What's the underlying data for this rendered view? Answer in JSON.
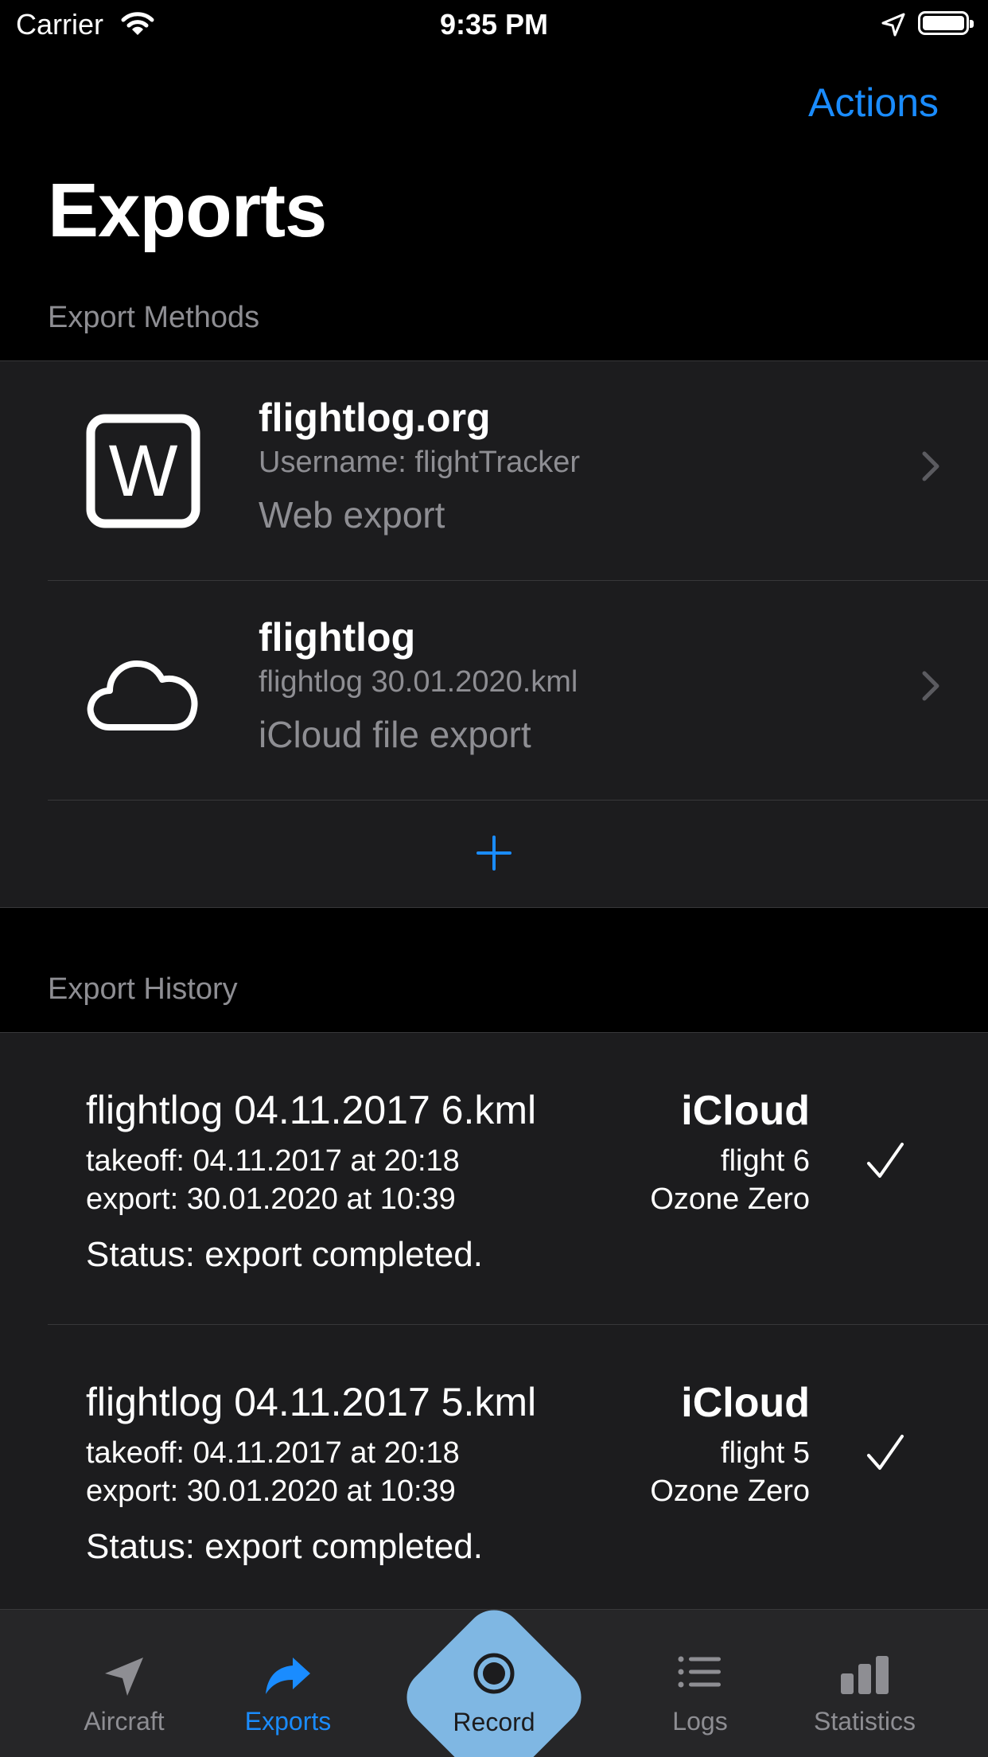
{
  "status_bar": {
    "carrier": "Carrier",
    "time": "9:35 PM",
    "icons": [
      "wifi-icon",
      "location-arrow-icon",
      "battery-icon"
    ]
  },
  "nav": {
    "actions_label": "Actions",
    "title": "Exports"
  },
  "export_methods": {
    "header": "Export Methods",
    "items": [
      {
        "icon": "w-square-icon",
        "title": "flightlog.org",
        "subtitle": "Username: flightTracker",
        "kind": "Web export"
      },
      {
        "icon": "cloud-icon",
        "title": "flightlog",
        "subtitle": "flightlog 30.01.2020.kml",
        "kind": "iCloud file export"
      }
    ],
    "add_icon": "plus-icon"
  },
  "export_history": {
    "header": "Export History",
    "items": [
      {
        "file": "flightlog 04.11.2017 6.kml",
        "takeoff": "takeoff: 04.11.2017 at 20:18",
        "export": "export: 30.01.2020 at 10:39",
        "status": "Status: export completed.",
        "service": "iCloud",
        "flight": "flight 6",
        "aircraft": "Ozone Zero",
        "state_icon": "checkmark-icon"
      },
      {
        "file": "flightlog 04.11.2017 5.kml",
        "takeoff": "takeoff: 04.11.2017 at 20:18",
        "export": "export: 30.01.2020 at 10:39",
        "status": "Status: export completed.",
        "service": "iCloud",
        "flight": "flight 5",
        "aircraft": "Ozone Zero",
        "state_icon": "checkmark-icon"
      }
    ]
  },
  "tab_bar": {
    "active": "Exports",
    "accent_color": "#1a8cff",
    "record_color": "#7fb7e3",
    "tabs": [
      {
        "label": "Aircraft",
        "icon": "paper-plane-icon"
      },
      {
        "label": "Exports",
        "icon": "share-arrow-icon"
      },
      {
        "label": "Record",
        "icon": "record-icon"
      },
      {
        "label": "Logs",
        "icon": "list-icon"
      },
      {
        "label": "Statistics",
        "icon": "bar-chart-icon"
      }
    ]
  }
}
